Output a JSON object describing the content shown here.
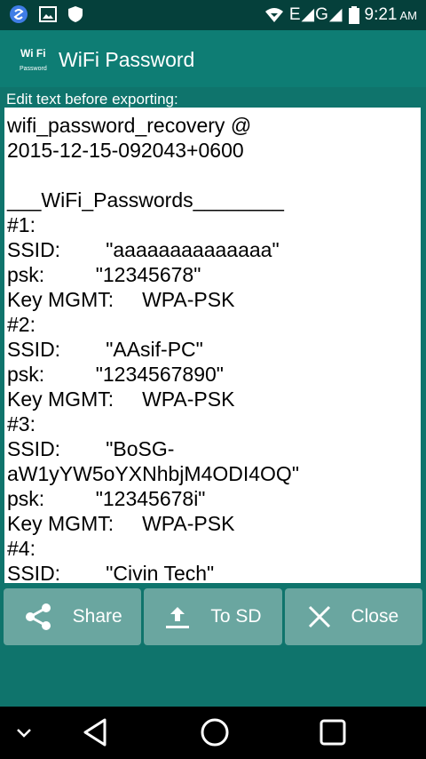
{
  "status_bar": {
    "network": "E◢G◢",
    "time": "9:21",
    "ampm": "AM"
  },
  "app": {
    "title": "WiFi Password",
    "logo_text_top": "Wi Fi",
    "logo_text_bottom": "Password"
  },
  "editor": {
    "label": "Edit text before exporting:",
    "lines": [
      "wifi_password_recovery @",
      "2015-12-15-092043+0600",
      "",
      "___WiFi_Passwords________",
      "#1:",
      "SSID:        \"aaaaaaaaaaaaaa\"",
      "psk:         \"12345678\"",
      "Key MGMT:     WPA-PSK",
      "#2:",
      "SSID:        \"AAsif-PC\"",
      "psk:         \"1234567890\"",
      "Key MGMT:     WPA-PSK",
      "#3:",
      "SSID:        \"BoSG-",
      "aW1yYW5oYXNhbjM4ODI4OQ\"",
      "psk:         \"12345678i\"",
      "Key MGMT:     WPA-PSK",
      "#4:",
      "SSID:        \"Civin Tech\""
    ]
  },
  "buttons": {
    "share": "Share",
    "to_sd": "To SD",
    "close": "Close"
  },
  "icons": {
    "share": "share-icon",
    "upload": "upload-icon",
    "close": "close-icon"
  },
  "colors": {
    "primary": "#0e7d74",
    "status_bar": "#05403b",
    "button": "#6aa6a0"
  }
}
